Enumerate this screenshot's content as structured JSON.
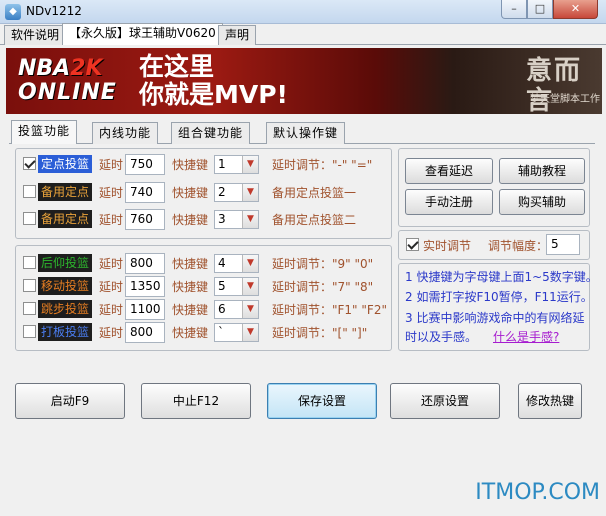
{
  "window": {
    "title": "NDv1212"
  },
  "top_tabs": [
    {
      "label": "软件说明"
    },
    {
      "label": "【永久版】球王辅助V0620"
    },
    {
      "label": "声明"
    }
  ],
  "banner": {
    "logo_top": "NBA",
    "logo_2k": "2K",
    "logo_bottom": "ONLINE",
    "slogan_line1": "在这里",
    "slogan_line2": "你就是MVP!",
    "brand": "意而言",
    "brand_sub": "梦天堂脚本工作"
  },
  "inner_tabs": [
    {
      "label": "投篮功能"
    },
    {
      "label": "内线功能"
    },
    {
      "label": "组合键功能"
    },
    {
      "label": "默认操作键"
    }
  ],
  "group1": {
    "rows": [
      {
        "name": "定点投篮",
        "checked": true,
        "delay_label": "延时",
        "delay": "750",
        "hotkey_label": "快捷键",
        "hotkey": "1",
        "note": "延时调节：\"-\" \"=\""
      },
      {
        "name": "备用定点",
        "checked": false,
        "delay_label": "延时",
        "delay": "740",
        "hotkey_label": "快捷键",
        "hotkey": "2",
        "note": "备用定点投篮一"
      },
      {
        "name": "备用定点",
        "checked": false,
        "delay_label": "延时",
        "delay": "760",
        "hotkey_label": "快捷键",
        "hotkey": "3",
        "note": "备用定点投篮二"
      }
    ]
  },
  "group2": {
    "rows": [
      {
        "name": "后仰投篮",
        "color": "#2db52d",
        "checked": false,
        "delay_label": "延时",
        "delay": "800",
        "hotkey_label": "快捷键",
        "hotkey": "4",
        "note": "延时调节：\"9\" \"0\""
      },
      {
        "name": "移动投篮",
        "color": "#e67e22",
        "checked": false,
        "delay_label": "延时",
        "delay": "1350",
        "hotkey_label": "快捷键",
        "hotkey": "5",
        "note": "延时调节：\"7\" \"8\""
      },
      {
        "name": "跳步投篮",
        "color": "#e67e22",
        "checked": false,
        "delay_label": "延时",
        "delay": "1100",
        "hotkey_label": "快捷键",
        "hotkey": "6",
        "note": "延时调节：\"F1\" \"F2\""
      },
      {
        "name": "打板投篮",
        "color": "#2b5ed7",
        "checked": false,
        "delay_label": "延时",
        "delay": "800",
        "hotkey_label": "快捷键",
        "hotkey": "`",
        "note": "延时调节：\"[\" \"]\""
      }
    ]
  },
  "side_buttons": {
    "check_delay": "查看延迟",
    "tutorial": "辅助教程",
    "manual_register": "手动注册",
    "buy": "购买辅助"
  },
  "realtime": {
    "label": "实时调节",
    "checked": true,
    "range_label": "调节幅度：",
    "range_value": "5"
  },
  "info": {
    "line1": "1 快捷键为字母键上面1~5数字键。",
    "line2": "2 如需打字按F10暂停，F11运行。",
    "line3": "3 比赛中影响游戏命中的有网络延",
    "line4": "时以及手感。",
    "link": "什么是手感?"
  },
  "bottom_buttons": {
    "start": "启动F9",
    "stop": "中止F12",
    "save": "保存设置",
    "restore": "还原设置",
    "hotkey": "修改热键"
  },
  "watermark": "ITMOP.COM",
  "window_buttons": {
    "min": "–",
    "max": "□",
    "close": "✕"
  },
  "icons": {
    "app": "app-icon",
    "combo_arrow": "chevron-down-icon"
  }
}
